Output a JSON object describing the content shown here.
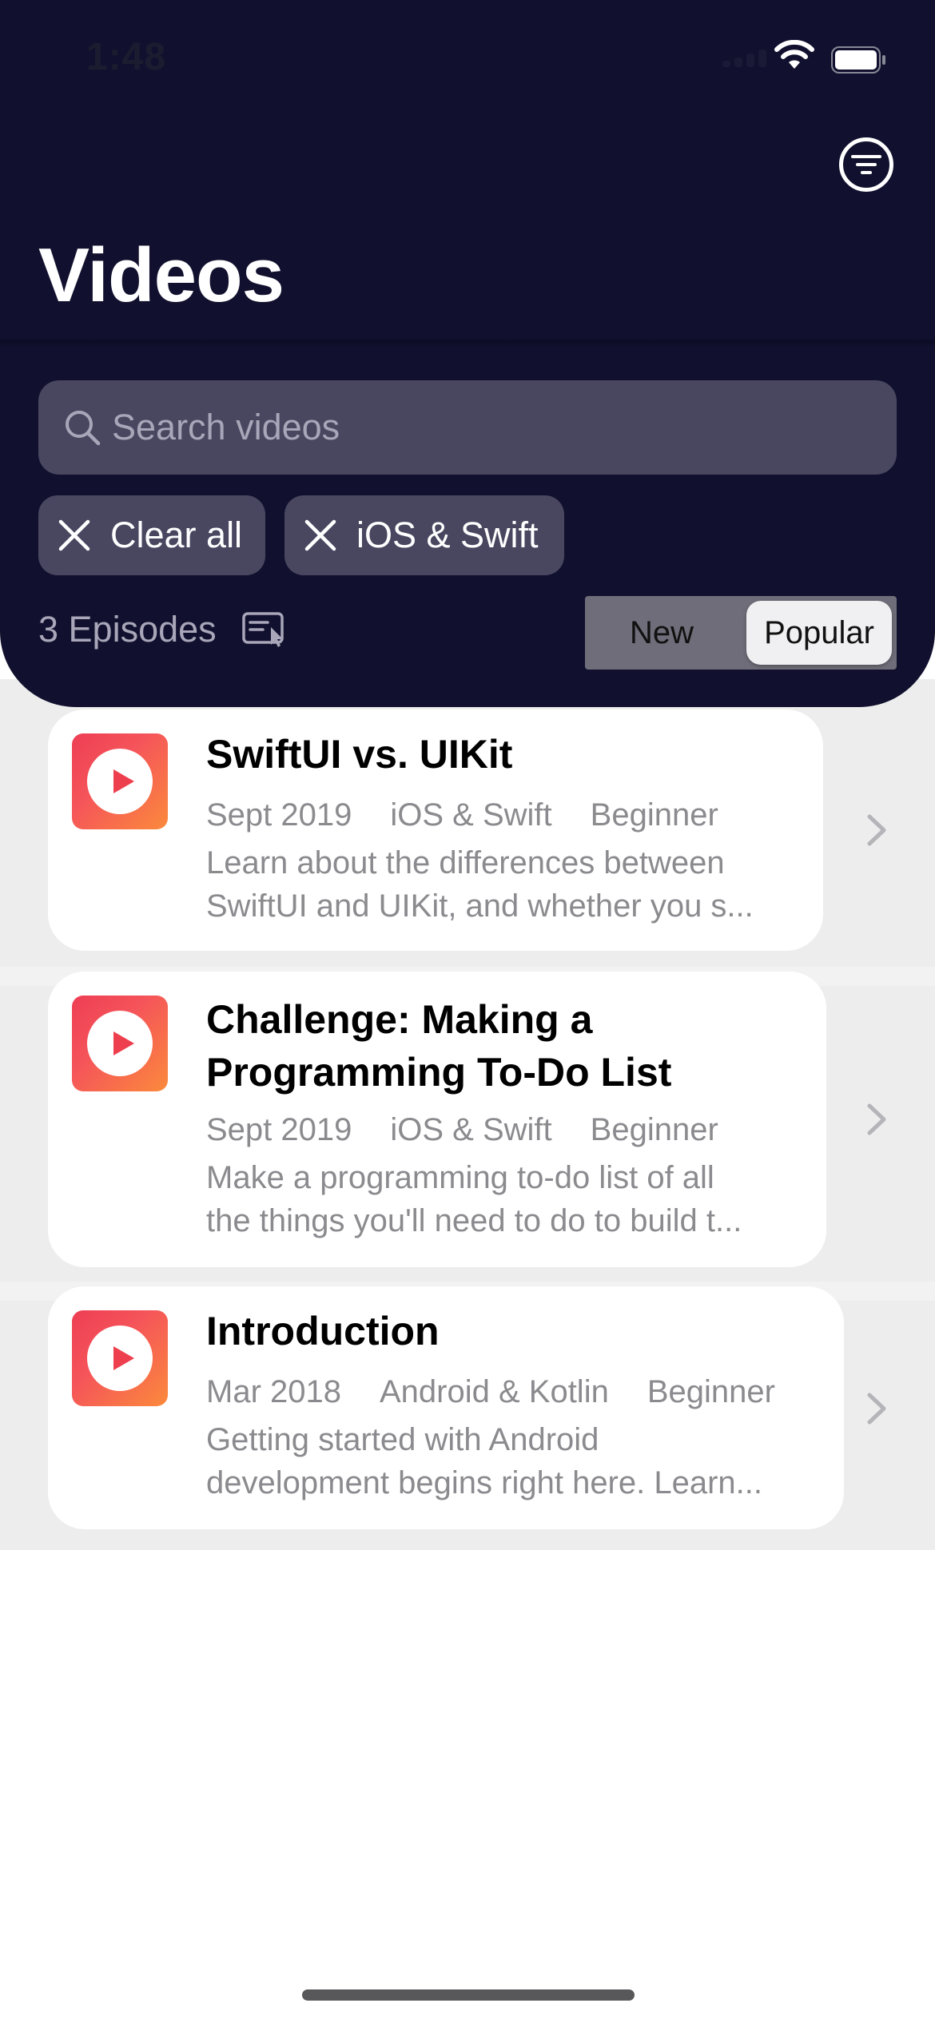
{
  "status_bar": {
    "time": "1:48"
  },
  "header": {
    "title": "Videos",
    "filter_icon": "filter-icon"
  },
  "search": {
    "placeholder": "Search videos",
    "value": ""
  },
  "filters": {
    "clear_all_label": "Clear all",
    "active_tags": [
      "iOS & Swift"
    ]
  },
  "episodes": {
    "count_label": "3 Episodes",
    "downloads_icon": "downloads-icon"
  },
  "sort": {
    "options": [
      "New",
      "Popular"
    ],
    "selected": "Popular"
  },
  "videos": [
    {
      "title_lines": [
        "SwiftUI vs. UIKit"
      ],
      "date": "Sept 2019",
      "platform": "iOS & Swift",
      "level": "Beginner",
      "description_lines": [
        "Learn about the differences between",
        "SwiftUI and UIKit, and whether you s..."
      ]
    },
    {
      "title_lines": [
        "Challenge: Making a",
        "Programming To-Do List"
      ],
      "date": "Sept 2019",
      "platform": "iOS & Swift",
      "level": "Beginner",
      "description_lines": [
        "Make a programming to-do list of all",
        "the things you'll need to do to build t..."
      ]
    },
    {
      "title_lines": [
        "Introduction"
      ],
      "date": "Mar 2018",
      "platform": "Android & Kotlin",
      "level": "Beginner",
      "description_lines": [
        "Getting started with Android",
        "development begins right here. Learn..."
      ]
    }
  ],
  "colors": {
    "header_bg": "#11112f",
    "chip_bg": "#494760",
    "thumb_gradient_start": "#ee3e54",
    "thumb_gradient_end": "#fb8a3c"
  }
}
